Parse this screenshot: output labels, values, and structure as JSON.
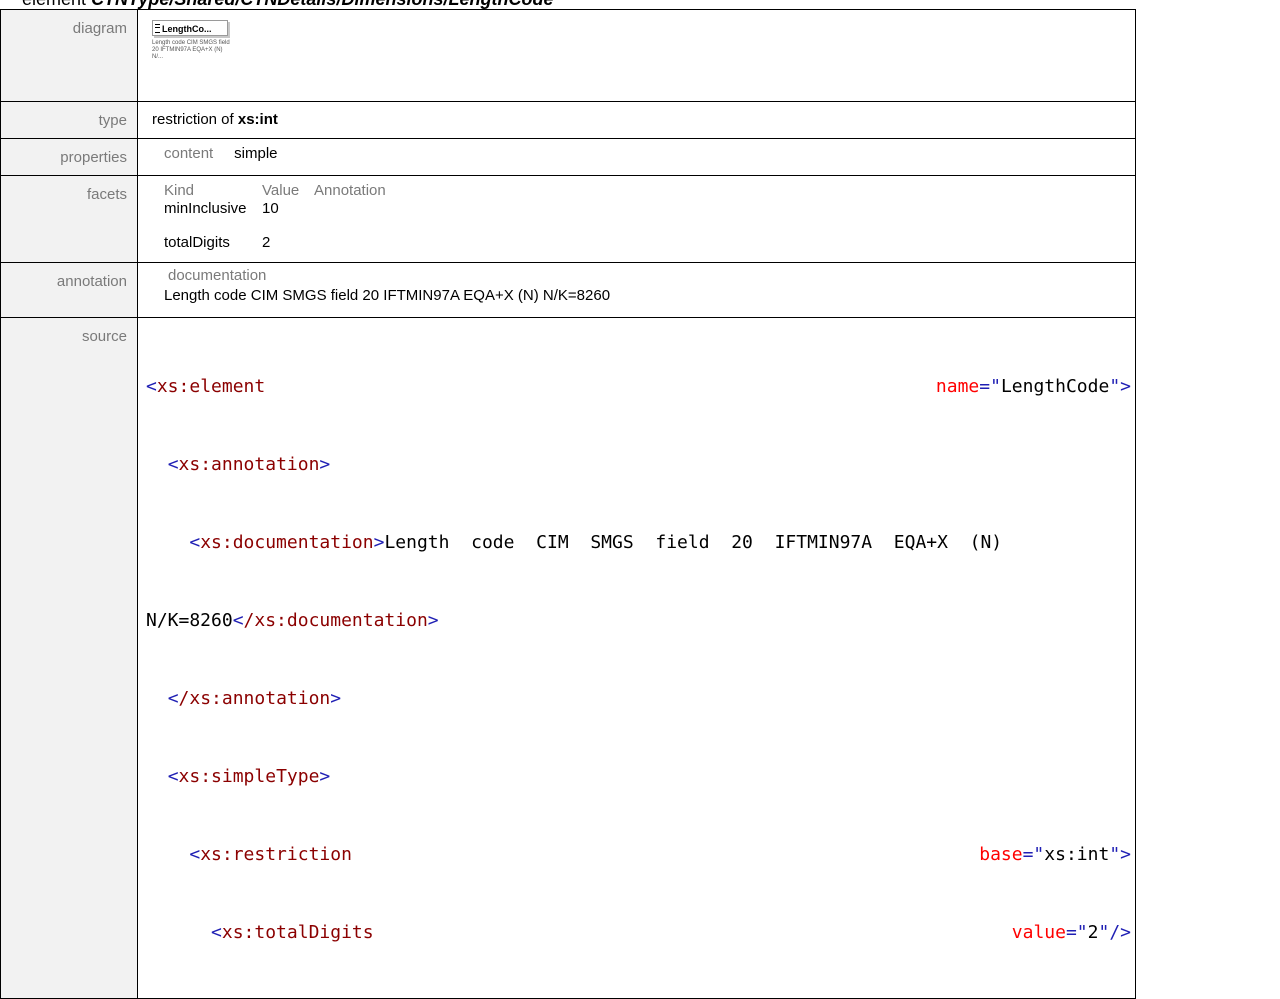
{
  "heading": {
    "prefix": "element",
    "path": "CTNType/Shared/CTNDetails/Dimensions/LengthCode"
  },
  "rows": {
    "diagram_label": "diagram",
    "type_label": "type",
    "properties_label": "properties",
    "facets_label": "facets",
    "annotation_label": "annotation",
    "source_label": "source"
  },
  "diagram": {
    "box_label": "LengthCo...",
    "note": "Length code CIM SMGS field 20 IFTMIN97A EQA+X (N) N/..."
  },
  "type": {
    "prefix": "restriction of",
    "base": "xs:int"
  },
  "properties": {
    "key": "content",
    "value": "simple"
  },
  "facets": {
    "headers": [
      "Kind",
      "Value",
      "Annotation"
    ],
    "rows": [
      {
        "kind": "minInclusive",
        "value": "10"
      },
      {
        "kind": "totalDigits",
        "value": "2"
      }
    ]
  },
  "annotation": {
    "heading": "documentation",
    "text": "Length code CIM SMGS field 20 IFTMIN97A EQA+X (N) N/K=8260"
  },
  "source": {
    "l1_tag": "xs:element",
    "l1_attr": "name",
    "l1_val": "LengthCode",
    "l2": "xs:annotation",
    "l3_tag": "xs:documentation",
    "l3_text": "Length  code  CIM  SMGS  field  20  IFTMIN97A  EQA+X  (N)",
    "l4_text": "N/K=8260",
    "l4_close": "/xs:documentation",
    "l5": "/xs:annotation",
    "l6": "xs:simpleType",
    "l7_tag": "xs:restriction",
    "l7_attr": "base",
    "l7_val": "xs:int",
    "l8_tag": "xs:totalDigits",
    "l8_attr": "value",
    "l8_val": "2"
  }
}
